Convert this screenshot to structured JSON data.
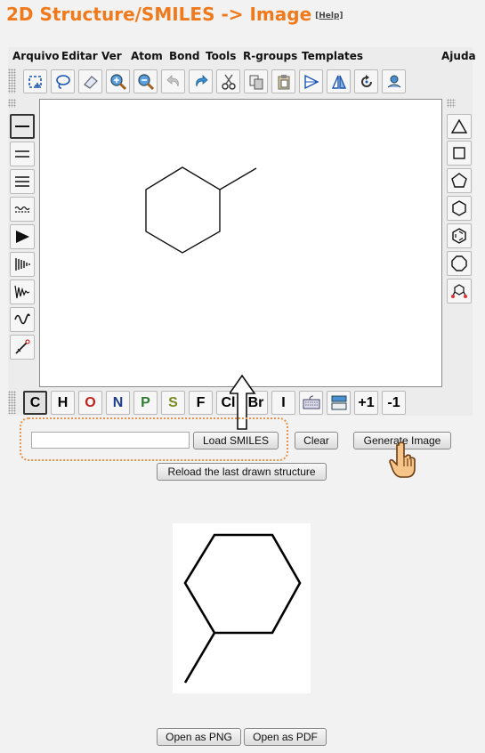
{
  "title": "2D Structure/SMILES -> Image",
  "help_link": "[Help]",
  "menu": [
    "Arquivo",
    "Editar",
    "Ver",
    "Atom",
    "Bond",
    "Tools",
    "R-groups",
    "Templates",
    "Ajuda"
  ],
  "toolbar_icons": [
    "select-icon",
    "lasso-icon",
    "eraser-icon",
    "zoom-in-icon",
    "zoom-out-icon",
    "undo-icon",
    "redo-icon",
    "cut-icon",
    "copy-icon",
    "paste-icon",
    "flip-horizontal-icon",
    "flip-vertical-icon",
    "rotate-icon",
    "clean-structure-icon"
  ],
  "bond_tools": [
    "single-bond",
    "double-bond",
    "triple-bond",
    "any-bond",
    "wedge-up-bond",
    "wedge-down-bond",
    "stereo-bond",
    "wavy-bond",
    "chain-tool"
  ],
  "template_tools": [
    "cyclopropane",
    "cyclobutane",
    "cyclopentane",
    "cyclohexane",
    "benzene",
    "cyclooctane",
    "template-library"
  ],
  "atoms": [
    {
      "label": "C",
      "color": "#111111"
    },
    {
      "label": "H",
      "color": "#111111"
    },
    {
      "label": "O",
      "color": "#c0221e"
    },
    {
      "label": "N",
      "color": "#1e3c8c"
    },
    {
      "label": "P",
      "color": "#2e7d32"
    },
    {
      "label": "S",
      "color": "#7a8a1e"
    },
    {
      "label": "F",
      "color": "#111111"
    },
    {
      "label": "Cl",
      "color": "#111111"
    },
    {
      "label": "Br",
      "color": "#111111"
    },
    {
      "label": "I",
      "color": "#111111"
    },
    {
      "label": "",
      "color": "#111111"
    },
    {
      "label": "",
      "color": "#111111"
    },
    {
      "label": "+1",
      "color": "#111111"
    },
    {
      "label": "-1",
      "color": "#111111"
    }
  ],
  "smiles_input": {
    "value": "",
    "placeholder": ""
  },
  "buttons": {
    "load_smiles": "Load SMILES",
    "clear": "Clear",
    "generate_image": "Generate Image",
    "reload": "Reload the last drawn structure",
    "open_png": "Open as PNG",
    "open_pdf": "Open as PDF"
  },
  "colors": {
    "title": "#f07a1b",
    "highlight_frame": "#e8944a"
  }
}
